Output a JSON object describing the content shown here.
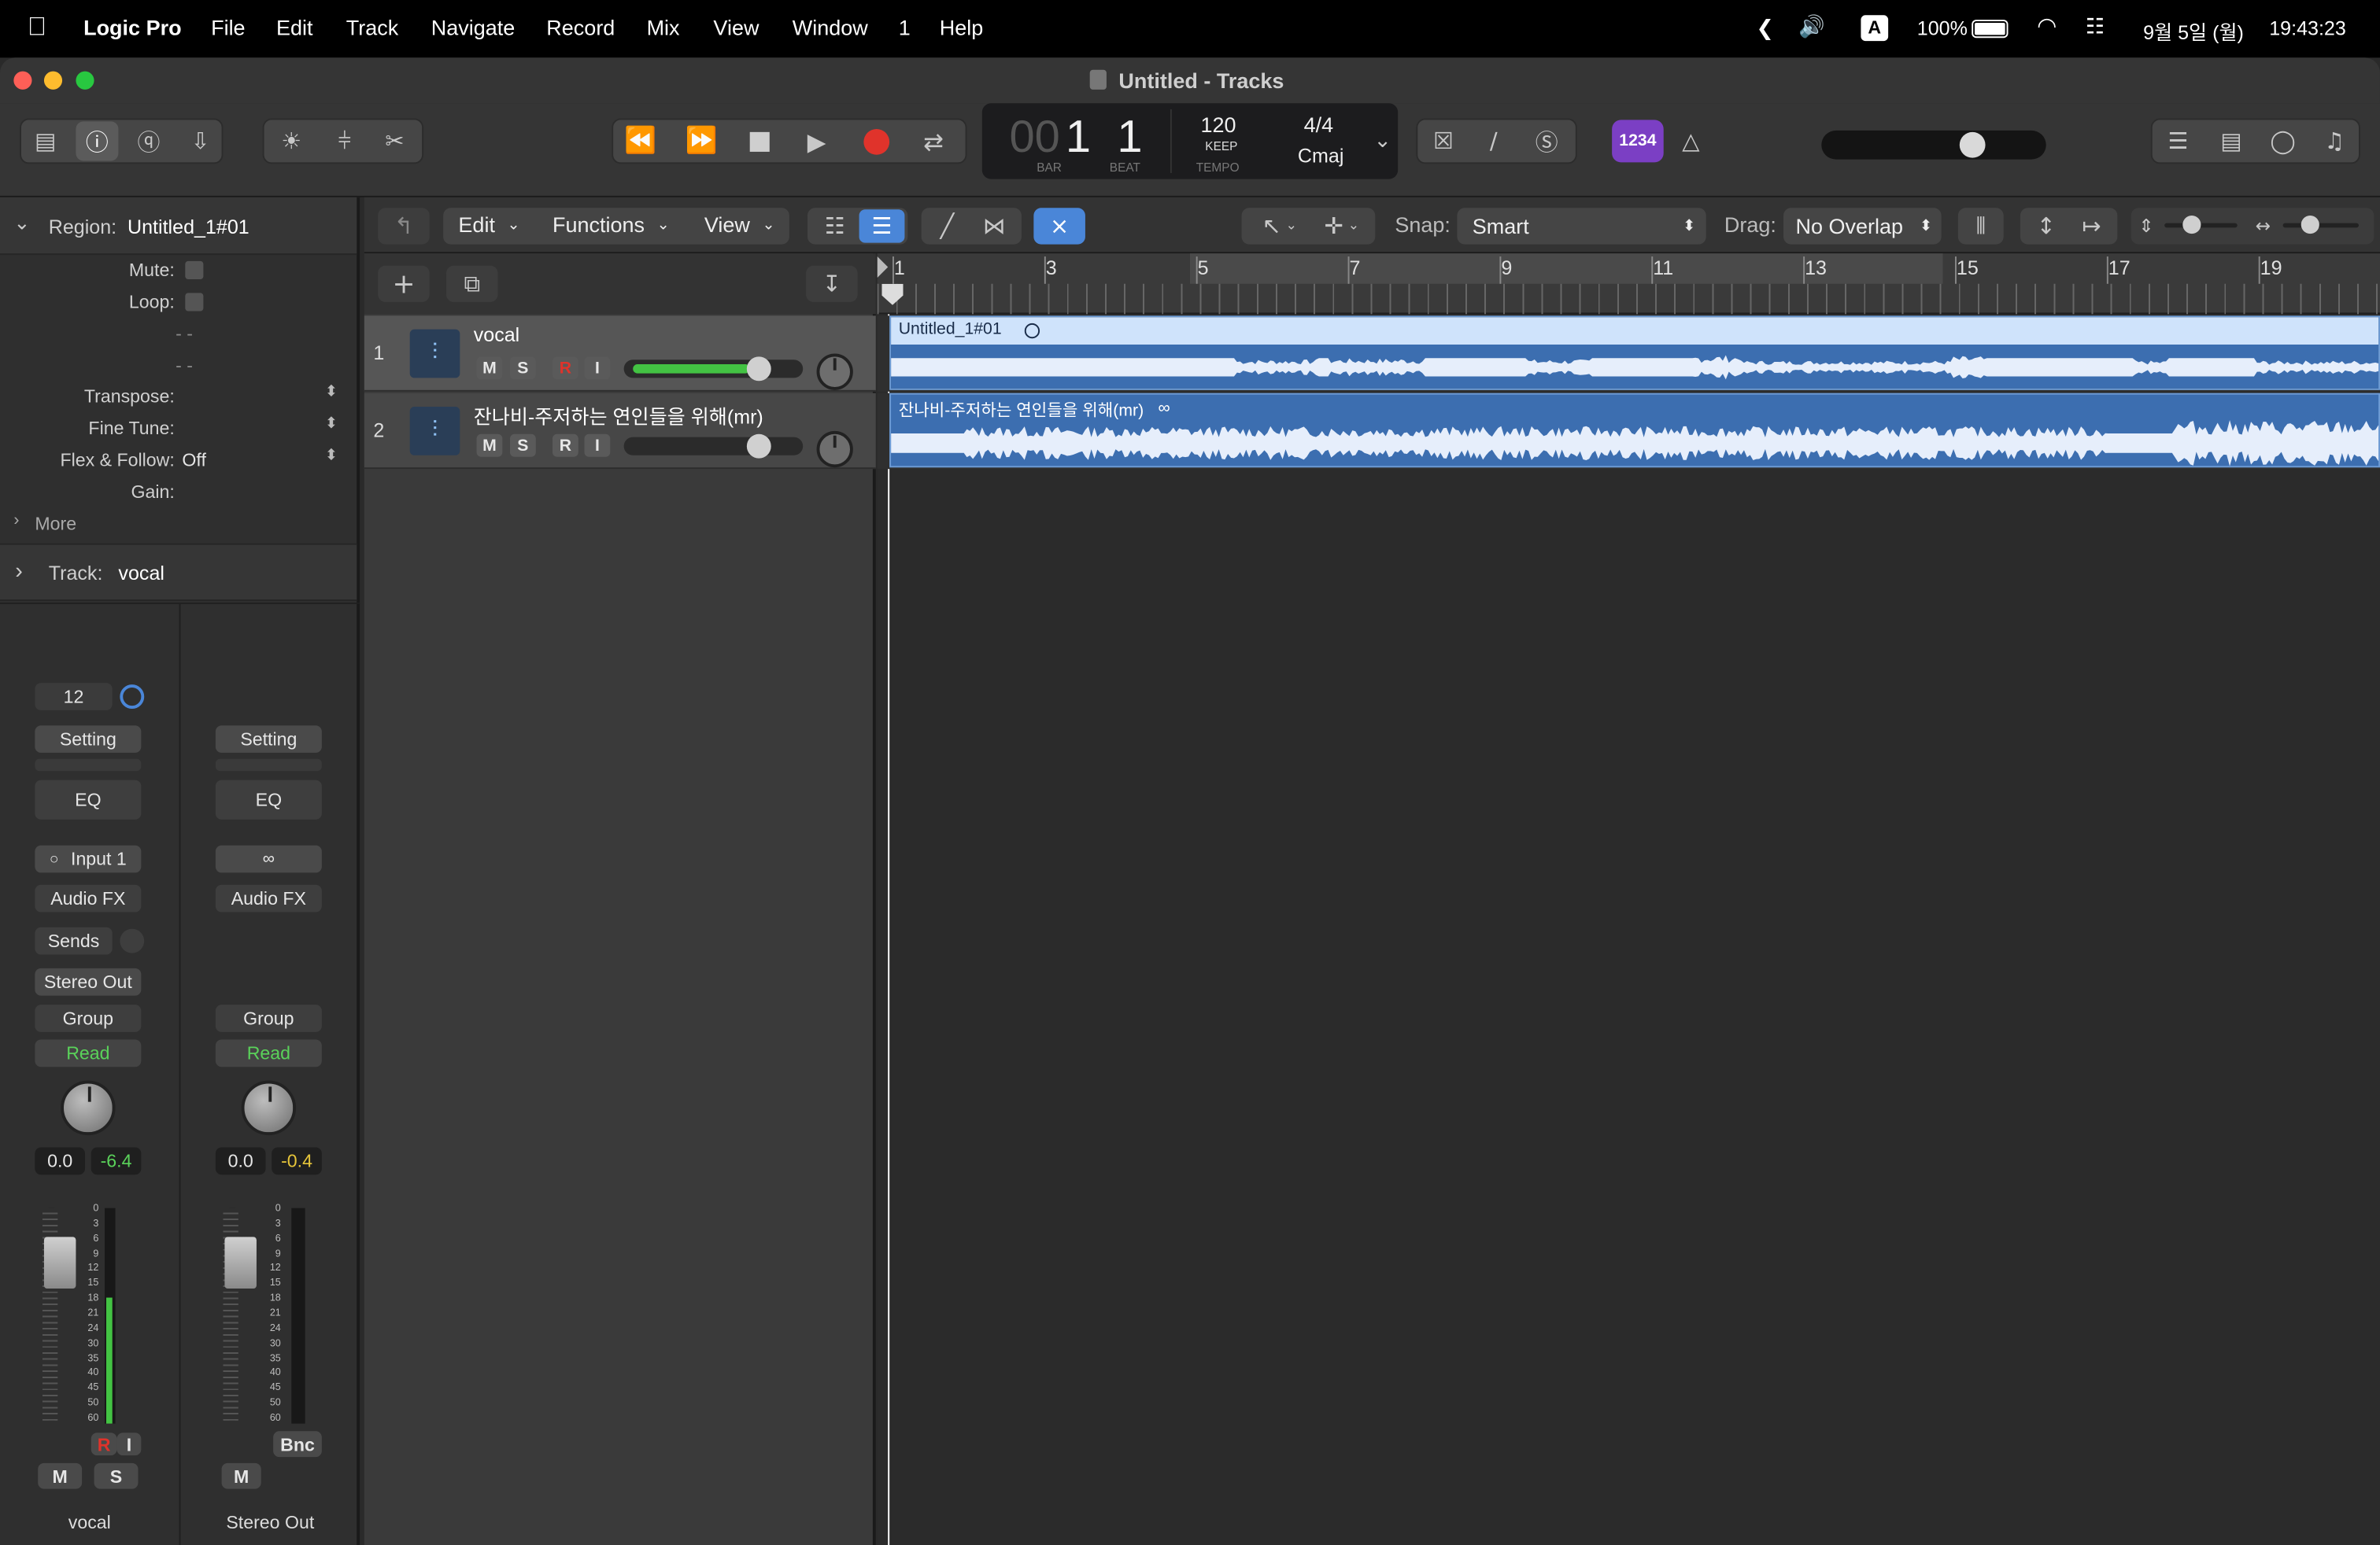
{
  "menubar": {
    "app": "Logic Pro",
    "menus": [
      "File",
      "Edit",
      "Track",
      "Navigate",
      "Record",
      "Mix",
      "View",
      "Window",
      "1",
      "Help"
    ],
    "input_indicator": "A",
    "battery": "100%",
    "date": "9월 5일 (월)",
    "time": "19:43:23"
  },
  "window": {
    "title": "Untitled - Tracks"
  },
  "lcd": {
    "bar": "1",
    "beat": "1",
    "bar_prefix": "00",
    "bar_label": "BAR",
    "beat_label": "BEAT",
    "tempo": "120",
    "tempo_mode": "KEEP",
    "tempo_label": "TEMPO",
    "signature": "4/4",
    "key": "Cmaj"
  },
  "count_in": "1234",
  "colors": {
    "accent_blue": "#3c6eb0",
    "record_red": "#e0332b",
    "read_green": "#5ad25a",
    "count_in_purple": "#7b3fc4",
    "active_blue": "#4a86d8"
  },
  "inspector": {
    "region_label": "Region:",
    "region_name": "Untitled_1#01",
    "mute_label": "Mute:",
    "loop_label": "Loop:",
    "dash1": "- -",
    "dash2": "- -",
    "transpose_label": "Transpose:",
    "finetune_label": "Fine Tune:",
    "flex_label": "Flex & Follow:",
    "flex_value": "Off",
    "gain_label": "Gain:",
    "more_label": "More",
    "track_label": "Track:",
    "track_name": "vocal"
  },
  "strips": [
    {
      "input_num": "12",
      "setting": "Setting",
      "eq": "EQ",
      "input": "Input 1",
      "audio_fx": "Audio FX",
      "sends": "Sends",
      "output": "Stereo Out",
      "group": "Group",
      "automation": "Read",
      "pan": "0.0",
      "level": "-6.4",
      "name": "vocal",
      "mute": "M",
      "solo": "S",
      "rec": "R",
      "inmon": "I"
    },
    {
      "setting": "Setting",
      "eq": "EQ",
      "audio_fx": "Audio FX",
      "group": "Group",
      "automation": "Read",
      "pan": "0.0",
      "level": "-0.4",
      "name": "Stereo Out",
      "mute": "M",
      "bounce": "Bnc"
    }
  ],
  "meter_scale": [
    "0",
    "3",
    "6",
    "9",
    "12",
    "15",
    "18",
    "21",
    "24",
    "30",
    "35",
    "40",
    "45",
    "50",
    "60"
  ],
  "tracks_toolbar": {
    "edit": "Edit",
    "functions": "Functions",
    "view": "View",
    "snap_label": "Snap:",
    "snap_value": "Smart",
    "drag_label": "Drag:",
    "drag_value": "No Overlap"
  },
  "ruler": [
    "1",
    "3",
    "5",
    "7",
    "9",
    "11",
    "13",
    "15",
    "17",
    "19"
  ],
  "tracks": [
    {
      "num": "1",
      "name": "vocal",
      "region": "Untitled_1#01",
      "m": "M",
      "s": "S",
      "r": "R",
      "i": "I",
      "volume_fraction": 0.75
    },
    {
      "num": "2",
      "name": "잔나비-주저하는 연인들을 위해(mr)",
      "region": "잔나비-주저하는 연인들을 위해(mr)",
      "m": "M",
      "s": "S",
      "r": "R",
      "i": "I",
      "volume_fraction": 0.75
    }
  ]
}
